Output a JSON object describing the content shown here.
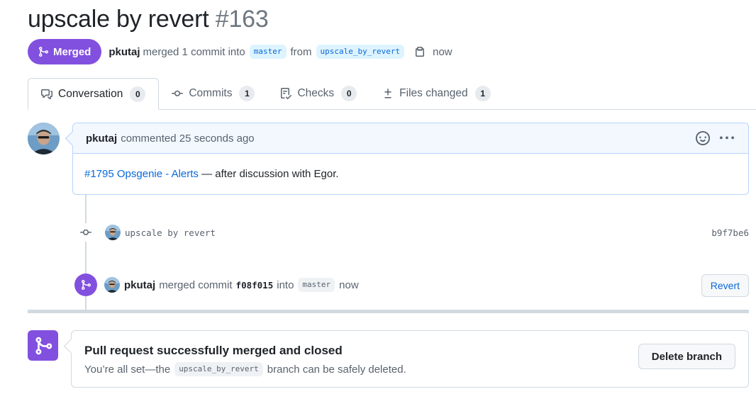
{
  "pr": {
    "title": "upscale by revert",
    "number": "#163",
    "state": "Merged",
    "author": "pkutaj",
    "merge_summary": "merged 1 commit into",
    "base_branch": "master",
    "from_word": "from",
    "head_branch": "upscale_by_revert",
    "time": "now"
  },
  "tabs": [
    {
      "label": "Conversation",
      "count": "0",
      "icon": "comment-discussion-icon"
    },
    {
      "label": "Commits",
      "count": "1",
      "icon": "git-commit-icon"
    },
    {
      "label": "Checks",
      "count": "0",
      "icon": "checklist-icon"
    },
    {
      "label": "Files changed",
      "count": "1",
      "icon": "file-diff-icon"
    }
  ],
  "comment": {
    "author": "pkutaj",
    "action": "commented 25 seconds ago",
    "link_text": "#1795 Opsgenie - Alerts",
    "body_text": " — after discussion with Egor."
  },
  "commit": {
    "message": "upscale by revert",
    "sha": "b9f7be6"
  },
  "merge_event": {
    "author": "pkutaj",
    "text_before": "merged commit",
    "sha": "f08f015",
    "text_into": "into",
    "branch": "master",
    "time": "now",
    "revert_label": "Revert"
  },
  "merge_box": {
    "title": "Pull request successfully merged and closed",
    "sub_before": "You’re all set—the",
    "branch": "upscale_by_revert",
    "sub_after": "branch can be safely deleted.",
    "delete_label": "Delete branch"
  },
  "colors": {
    "merged": "#8250df",
    "link": "#0969da",
    "comment_border": "#b6d4fa"
  }
}
